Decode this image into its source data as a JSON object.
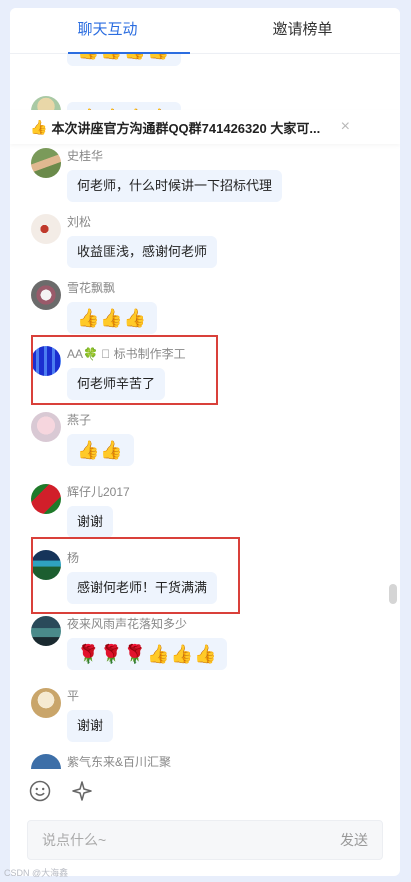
{
  "tabs": [
    {
      "label": "聊天互动",
      "active": true
    },
    {
      "label": "邀请榜单",
      "active": false
    }
  ],
  "notice": {
    "icon": "thumbs-up-icon",
    "text": "本次讲座官方沟通群QQ群741426320 大家可...",
    "close": "×"
  },
  "messages": [
    {
      "name": "",
      "text": "👍👍👍👍",
      "emoji": true
    },
    {
      "name": "",
      "text": "👍👍👍👍",
      "emoji": true
    },
    {
      "name": "史桂华",
      "text": "何老师，什么时候讲一下招标代理",
      "emoji": false
    },
    {
      "name": "刘松",
      "text": "收益匪浅，感谢何老师",
      "emoji": false
    },
    {
      "name": "雪花飘飘",
      "text": "👍👍👍",
      "emoji": true
    },
    {
      "name": "AA🍀 ⃞ 标书制作李工",
      "text": "何老师辛苦了",
      "emoji": false
    },
    {
      "name": "燕子",
      "text": "👍👍",
      "emoji": true
    },
    {
      "name": "辉仔儿2017",
      "text": "谢谢",
      "emoji": false
    },
    {
      "name": "杨",
      "text": "感谢何老师！干货满满",
      "emoji": false
    },
    {
      "name": "夜来风雨声花落知多少",
      "text": "🌹🌹🌹👍👍👍",
      "emoji": true
    },
    {
      "name": "平",
      "text": "谢谢",
      "emoji": false
    },
    {
      "name": "紫气东来&百川汇聚",
      "text": "",
      "emoji": false
    }
  ],
  "toolbar": {
    "emoji_icon": "smiley-icon",
    "gift_icon": "sparkle-icon"
  },
  "input": {
    "placeholder": "说点什么~",
    "send_label": "发送"
  },
  "watermark": "CSDN @大海鑫"
}
